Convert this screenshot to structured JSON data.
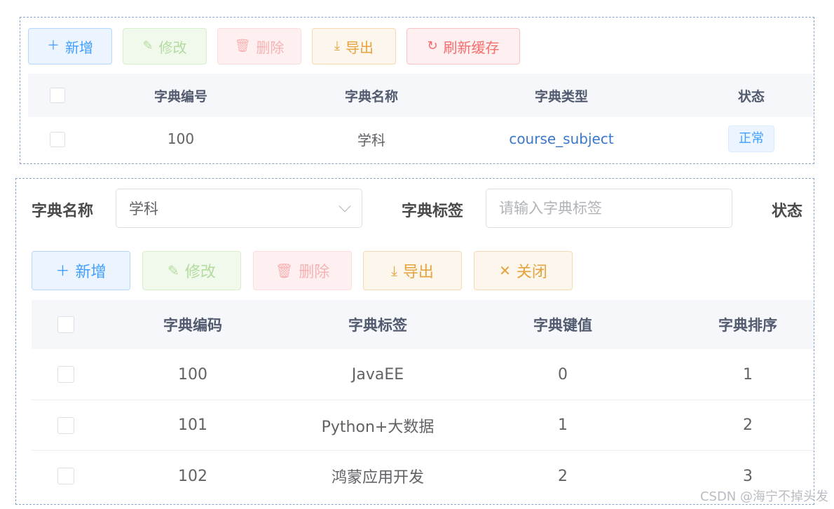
{
  "top_panel": {
    "toolbar": {
      "add_label": "新增",
      "edit_label": "修改",
      "delete_label": "删除",
      "export_label": "导出",
      "refresh_label": "刷新缓存"
    },
    "table": {
      "columns": [
        "字典编号",
        "字典名称",
        "字典类型",
        "状态"
      ],
      "rows": [
        {
          "id": "100",
          "name": "学科",
          "type": "course_subject",
          "status": "正常"
        }
      ]
    }
  },
  "bottom_panel": {
    "filter": {
      "dict_name_label": "字典名称",
      "dict_name_value": "学科",
      "dict_label_label": "字典标签",
      "dict_label_placeholder": "请输入字典标签",
      "status_label": "状态"
    },
    "toolbar": {
      "add_label": "新增",
      "edit_label": "修改",
      "delete_label": "删除",
      "export_label": "导出",
      "close_label": "关闭"
    },
    "table": {
      "columns": [
        "字典编码",
        "字典标签",
        "字典键值",
        "字典排序"
      ],
      "rows": [
        {
          "code": "100",
          "label": "JavaEE",
          "value": "0",
          "sort": "1"
        },
        {
          "code": "101",
          "label": "Python+大数据",
          "value": "1",
          "sort": "2"
        },
        {
          "code": "102",
          "label": "鸿蒙应用开发",
          "value": "2",
          "sort": "3"
        }
      ]
    }
  },
  "watermark": "CSDN @海宁不掉头发",
  "icons": {
    "add": "plus-icon",
    "edit": "edit-icon",
    "delete": "trash-icon",
    "export": "download-icon",
    "refresh": "refresh-icon",
    "close": "close-icon"
  }
}
